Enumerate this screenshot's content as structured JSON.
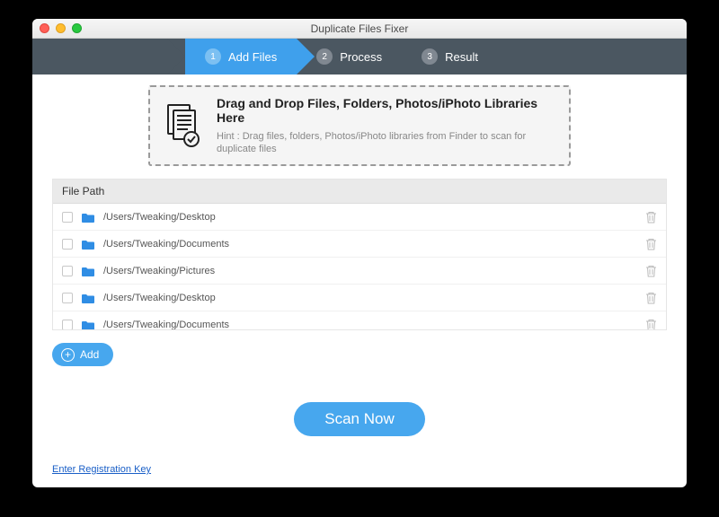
{
  "window": {
    "title": "Duplicate Files Fixer"
  },
  "steps": [
    {
      "num": "1",
      "label": "Add Files",
      "active": true
    },
    {
      "num": "2",
      "label": "Process",
      "active": false
    },
    {
      "num": "3",
      "label": "Result",
      "active": false
    }
  ],
  "dropzone": {
    "title": "Drag and Drop Files, Folders, Photos/iPhoto Libraries Here",
    "hint": "Hint : Drag files, folders, Photos/iPhoto libraries from Finder to scan for duplicate files"
  },
  "list": {
    "header": "File Path",
    "rows": [
      {
        "path": "/Users/Tweaking/Desktop"
      },
      {
        "path": "/Users/Tweaking/Documents"
      },
      {
        "path": "/Users/Tweaking/Pictures"
      },
      {
        "path": "/Users/Tweaking/Desktop"
      },
      {
        "path": "/Users/Tweaking/Documents"
      }
    ]
  },
  "buttons": {
    "add": "Add",
    "scan": "Scan Now"
  },
  "footer": {
    "registration": "Enter Registration Key"
  }
}
